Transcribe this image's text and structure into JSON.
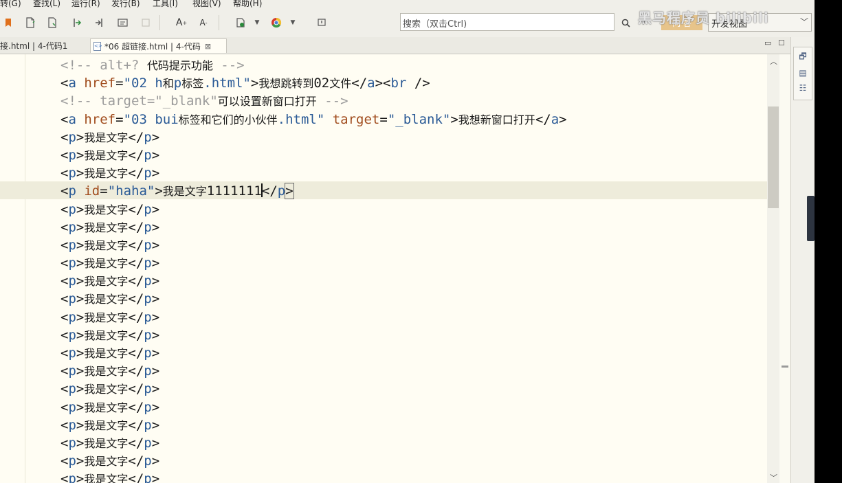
{
  "menu": {
    "items": [
      "转(G)",
      "查找(L)",
      "运行(R)",
      "发行(B)",
      "工具(I)",
      "视图(V)",
      "帮助(H)"
    ]
  },
  "toolbar": {
    "search_placeholder": "搜索（双击Ctrl)",
    "ask_label": "问 答",
    "view_select": "开发视图",
    "watermark": "黑马程序员 bilibili",
    "icons": [
      "bookmark-icon",
      "new-file-icon",
      "save-icon",
      "step-icon",
      "step-into-icon",
      "folder-icon",
      "disabled-icon",
      "font-increase-icon",
      "font-decrease-icon",
      "run-icon",
      "browser-icon",
      "info-icon",
      "search-icon"
    ]
  },
  "tabs": [
    {
      "label": "接.html | 4-代码1",
      "active": false
    },
    {
      "label": "*06 超链接.html | 4-代码",
      "active": true
    }
  ],
  "editor": {
    "lines": [
      [
        [
          "cm",
          "<!-- alt+? "
        ],
        [
          "text-cm",
          "代码提示功能"
        ],
        [
          "cm",
          " -->"
        ]
      ],
      [
        [
          "br",
          "<"
        ],
        [
          "tag",
          "a "
        ],
        [
          "attr",
          "href"
        ],
        [
          "br",
          "="
        ],
        [
          "val",
          "\"02 h"
        ],
        [
          "text-val",
          "和"
        ],
        [
          "val",
          "p"
        ],
        [
          "text-val",
          "标签"
        ],
        [
          "val",
          ".html\""
        ],
        [
          "br",
          ">"
        ],
        [
          "text",
          "我想跳转到"
        ],
        [
          "br",
          "02"
        ],
        [
          "text",
          "文件"
        ],
        [
          "br",
          "</"
        ],
        [
          "tag",
          "a"
        ],
        [
          "br",
          "><"
        ],
        [
          "tag",
          "br "
        ],
        [
          "br",
          "/>"
        ]
      ],
      [
        [
          "cm",
          "<!-- target=\"_blank\""
        ],
        [
          "text-cm",
          "可以设置新窗口打开"
        ],
        [
          "cm",
          " -->"
        ]
      ],
      [
        [
          "br",
          "<"
        ],
        [
          "tag",
          "a "
        ],
        [
          "attr",
          "href"
        ],
        [
          "br",
          "="
        ],
        [
          "val",
          "\"03 bui"
        ],
        [
          "text-val",
          "标签和它们的小伙伴"
        ],
        [
          "val",
          ".html\" "
        ],
        [
          "attr",
          "target"
        ],
        [
          "br",
          "="
        ],
        [
          "val",
          "\"_blank\""
        ],
        [
          "br",
          ">"
        ],
        [
          "text",
          "我想新窗口打开"
        ],
        [
          "br",
          "</"
        ],
        [
          "tag",
          "a"
        ],
        [
          "br",
          ">"
        ]
      ],
      [
        [
          "br",
          "<"
        ],
        [
          "tag",
          "p"
        ],
        [
          "br",
          ">"
        ],
        [
          "text",
          "我是文字"
        ],
        [
          "br",
          "</"
        ],
        [
          "tag",
          "p"
        ],
        [
          "br",
          ">"
        ]
      ],
      [
        [
          "br",
          "<"
        ],
        [
          "tag",
          "p"
        ],
        [
          "br",
          ">"
        ],
        [
          "text",
          "我是文字"
        ],
        [
          "br",
          "</"
        ],
        [
          "tag",
          "p"
        ],
        [
          "br",
          ">"
        ]
      ],
      [
        [
          "br",
          "<"
        ],
        [
          "tag",
          "p"
        ],
        [
          "br",
          ">"
        ],
        [
          "text",
          "我是文字"
        ],
        [
          "br",
          "</"
        ],
        [
          "tag",
          "p"
        ],
        [
          "br",
          ">"
        ]
      ],
      [
        [
          "br",
          "<"
        ],
        [
          "tag",
          "p "
        ],
        [
          "attr",
          "id"
        ],
        [
          "br",
          "="
        ],
        [
          "val",
          "\"haha\""
        ],
        [
          "br",
          ">"
        ],
        [
          "text",
          "我是文字"
        ],
        [
          "br",
          "1111111"
        ],
        [
          "cursor",
          ""
        ],
        [
          "br",
          "</"
        ],
        [
          "tag",
          "p"
        ],
        [
          "match",
          ">"
        ]
      ],
      [
        [
          "br",
          "<"
        ],
        [
          "tag",
          "p"
        ],
        [
          "br",
          ">"
        ],
        [
          "text",
          "我是文字"
        ],
        [
          "br",
          "</"
        ],
        [
          "tag",
          "p"
        ],
        [
          "br",
          ">"
        ]
      ],
      [
        [
          "br",
          "<"
        ],
        [
          "tag",
          "p"
        ],
        [
          "br",
          ">"
        ],
        [
          "text",
          "我是文字"
        ],
        [
          "br",
          "</"
        ],
        [
          "tag",
          "p"
        ],
        [
          "br",
          ">"
        ]
      ],
      [
        [
          "br",
          "<"
        ],
        [
          "tag",
          "p"
        ],
        [
          "br",
          ">"
        ],
        [
          "text",
          "我是文字"
        ],
        [
          "br",
          "</"
        ],
        [
          "tag",
          "p"
        ],
        [
          "br",
          ">"
        ]
      ],
      [
        [
          "br",
          "<"
        ],
        [
          "tag",
          "p"
        ],
        [
          "br",
          ">"
        ],
        [
          "text",
          "我是文字"
        ],
        [
          "br",
          "</"
        ],
        [
          "tag",
          "p"
        ],
        [
          "br",
          ">"
        ]
      ],
      [
        [
          "br",
          "<"
        ],
        [
          "tag",
          "p"
        ],
        [
          "br",
          ">"
        ],
        [
          "text",
          "我是文字"
        ],
        [
          "br",
          "</"
        ],
        [
          "tag",
          "p"
        ],
        [
          "br",
          ">"
        ]
      ],
      [
        [
          "br",
          "<"
        ],
        [
          "tag",
          "p"
        ],
        [
          "br",
          ">"
        ],
        [
          "text",
          "我是文字"
        ],
        [
          "br",
          "</"
        ],
        [
          "tag",
          "p"
        ],
        [
          "br",
          ">"
        ]
      ],
      [
        [
          "br",
          "<"
        ],
        [
          "tag",
          "p"
        ],
        [
          "br",
          ">"
        ],
        [
          "text",
          "我是文字"
        ],
        [
          "br",
          "</"
        ],
        [
          "tag",
          "p"
        ],
        [
          "br",
          ">"
        ]
      ],
      [
        [
          "br",
          "<"
        ],
        [
          "tag",
          "p"
        ],
        [
          "br",
          ">"
        ],
        [
          "text",
          "我是文字"
        ],
        [
          "br",
          "</"
        ],
        [
          "tag",
          "p"
        ],
        [
          "br",
          ">"
        ]
      ],
      [
        [
          "br",
          "<"
        ],
        [
          "tag",
          "p"
        ],
        [
          "br",
          ">"
        ],
        [
          "text",
          "我是文字"
        ],
        [
          "br",
          "</"
        ],
        [
          "tag",
          "p"
        ],
        [
          "br",
          ">"
        ]
      ],
      [
        [
          "br",
          "<"
        ],
        [
          "tag",
          "p"
        ],
        [
          "br",
          ">"
        ],
        [
          "text",
          "我是文字"
        ],
        [
          "br",
          "</"
        ],
        [
          "tag",
          "p"
        ],
        [
          "br",
          ">"
        ]
      ],
      [
        [
          "br",
          "<"
        ],
        [
          "tag",
          "p"
        ],
        [
          "br",
          ">"
        ],
        [
          "text",
          "我是文字"
        ],
        [
          "br",
          "</"
        ],
        [
          "tag",
          "p"
        ],
        [
          "br",
          ">"
        ]
      ],
      [
        [
          "br",
          "<"
        ],
        [
          "tag",
          "p"
        ],
        [
          "br",
          ">"
        ],
        [
          "text",
          "我是文字"
        ],
        [
          "br",
          "</"
        ],
        [
          "tag",
          "p"
        ],
        [
          "br",
          ">"
        ]
      ],
      [
        [
          "br",
          "<"
        ],
        [
          "tag",
          "p"
        ],
        [
          "br",
          ">"
        ],
        [
          "text",
          "我是文字"
        ],
        [
          "br",
          "</"
        ],
        [
          "tag",
          "p"
        ],
        [
          "br",
          ">"
        ]
      ],
      [
        [
          "br",
          "<"
        ],
        [
          "tag",
          "p"
        ],
        [
          "br",
          ">"
        ],
        [
          "text",
          "我是文字"
        ],
        [
          "br",
          "</"
        ],
        [
          "tag",
          "p"
        ],
        [
          "br",
          ">"
        ]
      ],
      [
        [
          "br",
          "<"
        ],
        [
          "tag",
          "p"
        ],
        [
          "br",
          ">"
        ],
        [
          "text",
          "我是文字"
        ],
        [
          "br",
          "</"
        ],
        [
          "tag",
          "p"
        ],
        [
          "br",
          ">"
        ]
      ],
      [
        [
          "br",
          "<"
        ],
        [
          "tag",
          "p"
        ],
        [
          "br",
          ">"
        ],
        [
          "text",
          "我是文字"
        ],
        [
          "br",
          "</"
        ],
        [
          "tag",
          "p"
        ],
        [
          "br",
          ">"
        ]
      ]
    ]
  },
  "colors": {
    "tag": "#2a5a96",
    "attr": "#a04b1c",
    "comment": "#9b9b9b",
    "editor_bg": "#fffdf3",
    "current_line": "#eeecdb"
  }
}
